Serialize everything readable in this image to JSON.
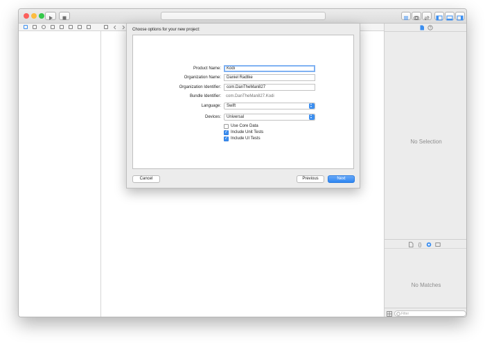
{
  "colors": {
    "accent": "#3b8ef0",
    "close": "#fc605c",
    "minimize": "#fdbc40",
    "zoom": "#34c84a"
  },
  "toolbar": {
    "run_icon": "play-icon",
    "stop_icon": "stop-icon"
  },
  "inspector": {
    "no_selection": "No Selection",
    "no_matches": "No Matches",
    "filter_placeholder": "Filter"
  },
  "sheet": {
    "title": "Choose options for your new project:",
    "product_name_label": "Product Name:",
    "product_name_value": "Kodi",
    "organization_name_label": "Organization Name:",
    "organization_name_value": "Daniel Radtke",
    "organization_identifier_label": "Organization Identifier:",
    "organization_identifier_value": "com.DanTheMan827",
    "bundle_identifier_label": "Bundle Identifier:",
    "bundle_identifier_value": "com.DanTheMan827.Kodi",
    "language_label": "Language:",
    "language_value": "Swift",
    "devices_label": "Devices:",
    "devices_value": "Universal",
    "use_core_data": {
      "label": "Use Core Data",
      "checked": false
    },
    "include_unit_tests": {
      "label": "Include Unit Tests",
      "checked": true
    },
    "include_ui_tests": {
      "label": "Include UI Tests",
      "checked": true
    },
    "cancel_label": "Cancel",
    "previous_label": "Previous",
    "next_label": "Next"
  }
}
